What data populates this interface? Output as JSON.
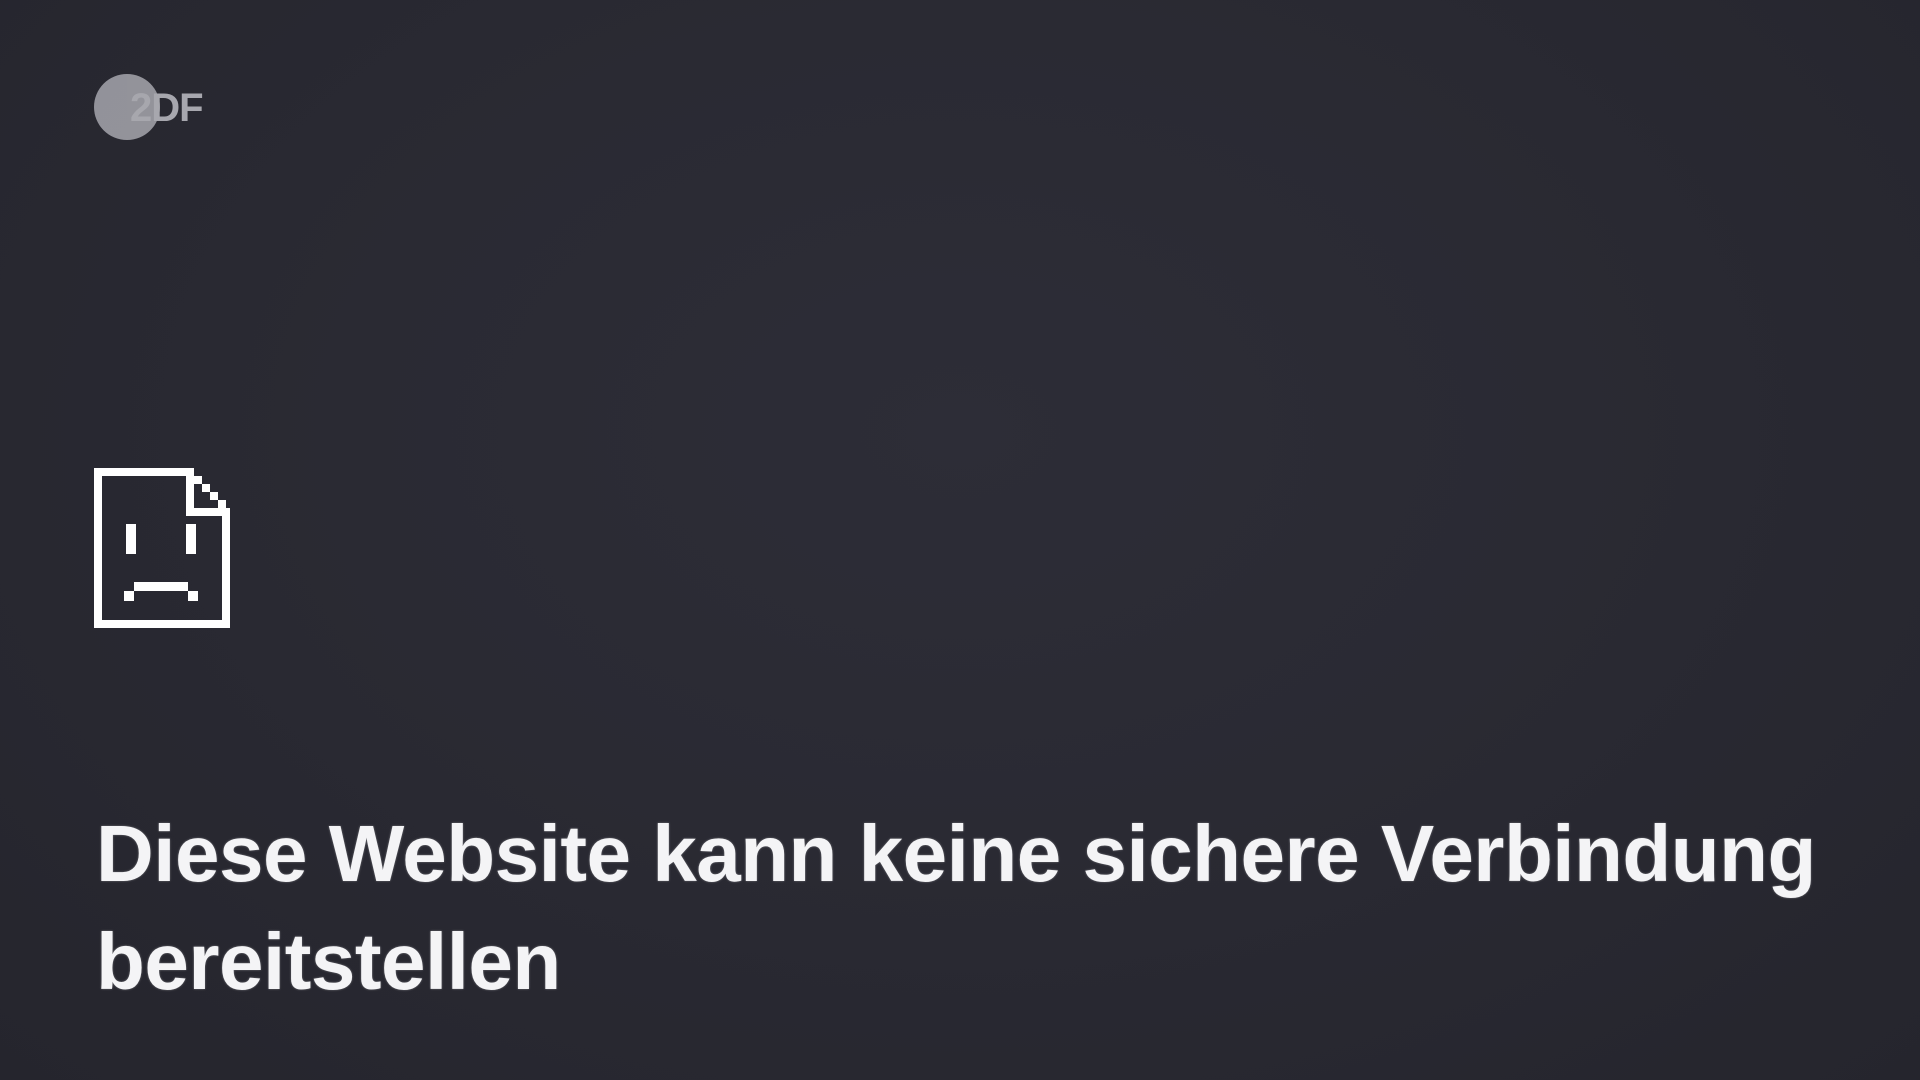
{
  "broadcaster": {
    "logo_text": "2DF",
    "icon": "zdf-logo"
  },
  "error_page": {
    "icon": "sad-document-icon",
    "heading": "Diese Website kann keine sichere Verbindung bereitstellen"
  },
  "colors": {
    "background": "#2a2a33",
    "text": "#f4f4f6",
    "logo": "#bdbdc3"
  }
}
